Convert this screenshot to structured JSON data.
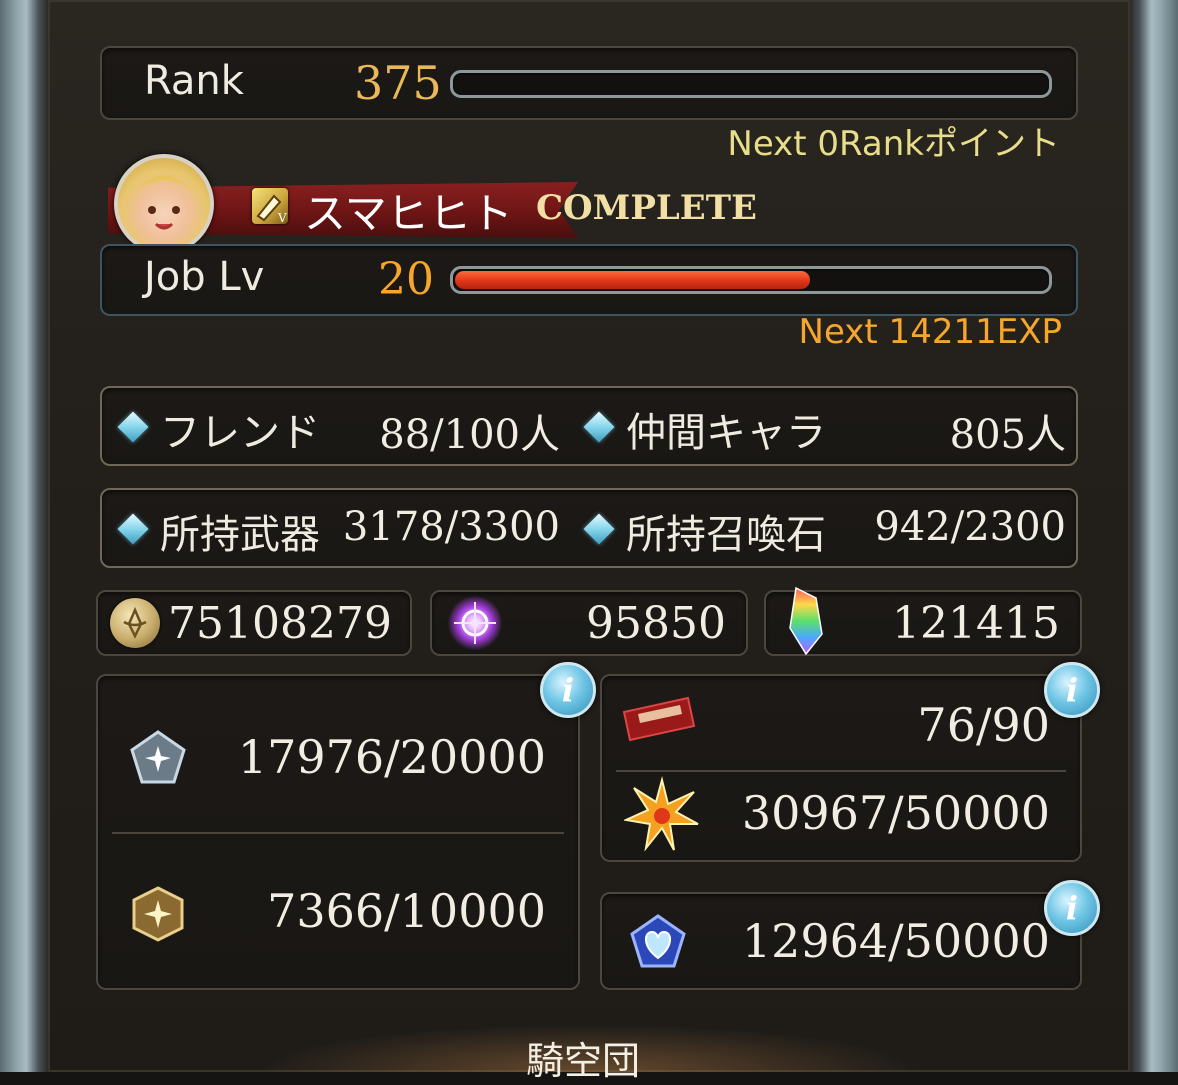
{
  "rank": {
    "label": "Rank",
    "value": "375",
    "next": "Next 0Rankポイント",
    "progress": 0
  },
  "job": {
    "name": "スマヒヒト",
    "status": "COMPLETE",
    "label": "Job Lv",
    "level": "20",
    "next": "Next 14211EXP",
    "progress": 0.6,
    "icon": "job-class-icon",
    "avatar": "character-avatar"
  },
  "counts": {
    "friend_label": "フレンド",
    "friend_value": "88/100人",
    "ally_label": "仲間キャラ",
    "ally_value": "805人",
    "weapon_label": "所持武器",
    "weapon_value": "3178/3300",
    "summon_label": "所持召喚石",
    "summon_value": "942/2300"
  },
  "currency": {
    "rupie": "75108279",
    "crystal_points": "95850",
    "crystals": "121415"
  },
  "stock": {
    "left_top": "17976/20000",
    "left_bottom": "7366/10000",
    "ticket": "76/90",
    "burst": "30967/50000",
    "heart": "12964/50000"
  },
  "footer": {
    "title": "騎空団"
  },
  "colors": {
    "accent": "#f6a62a",
    "rank_gold": "#e8b85a",
    "bar_red": "#e0361a",
    "next_yellow": "#e8dd8a"
  }
}
